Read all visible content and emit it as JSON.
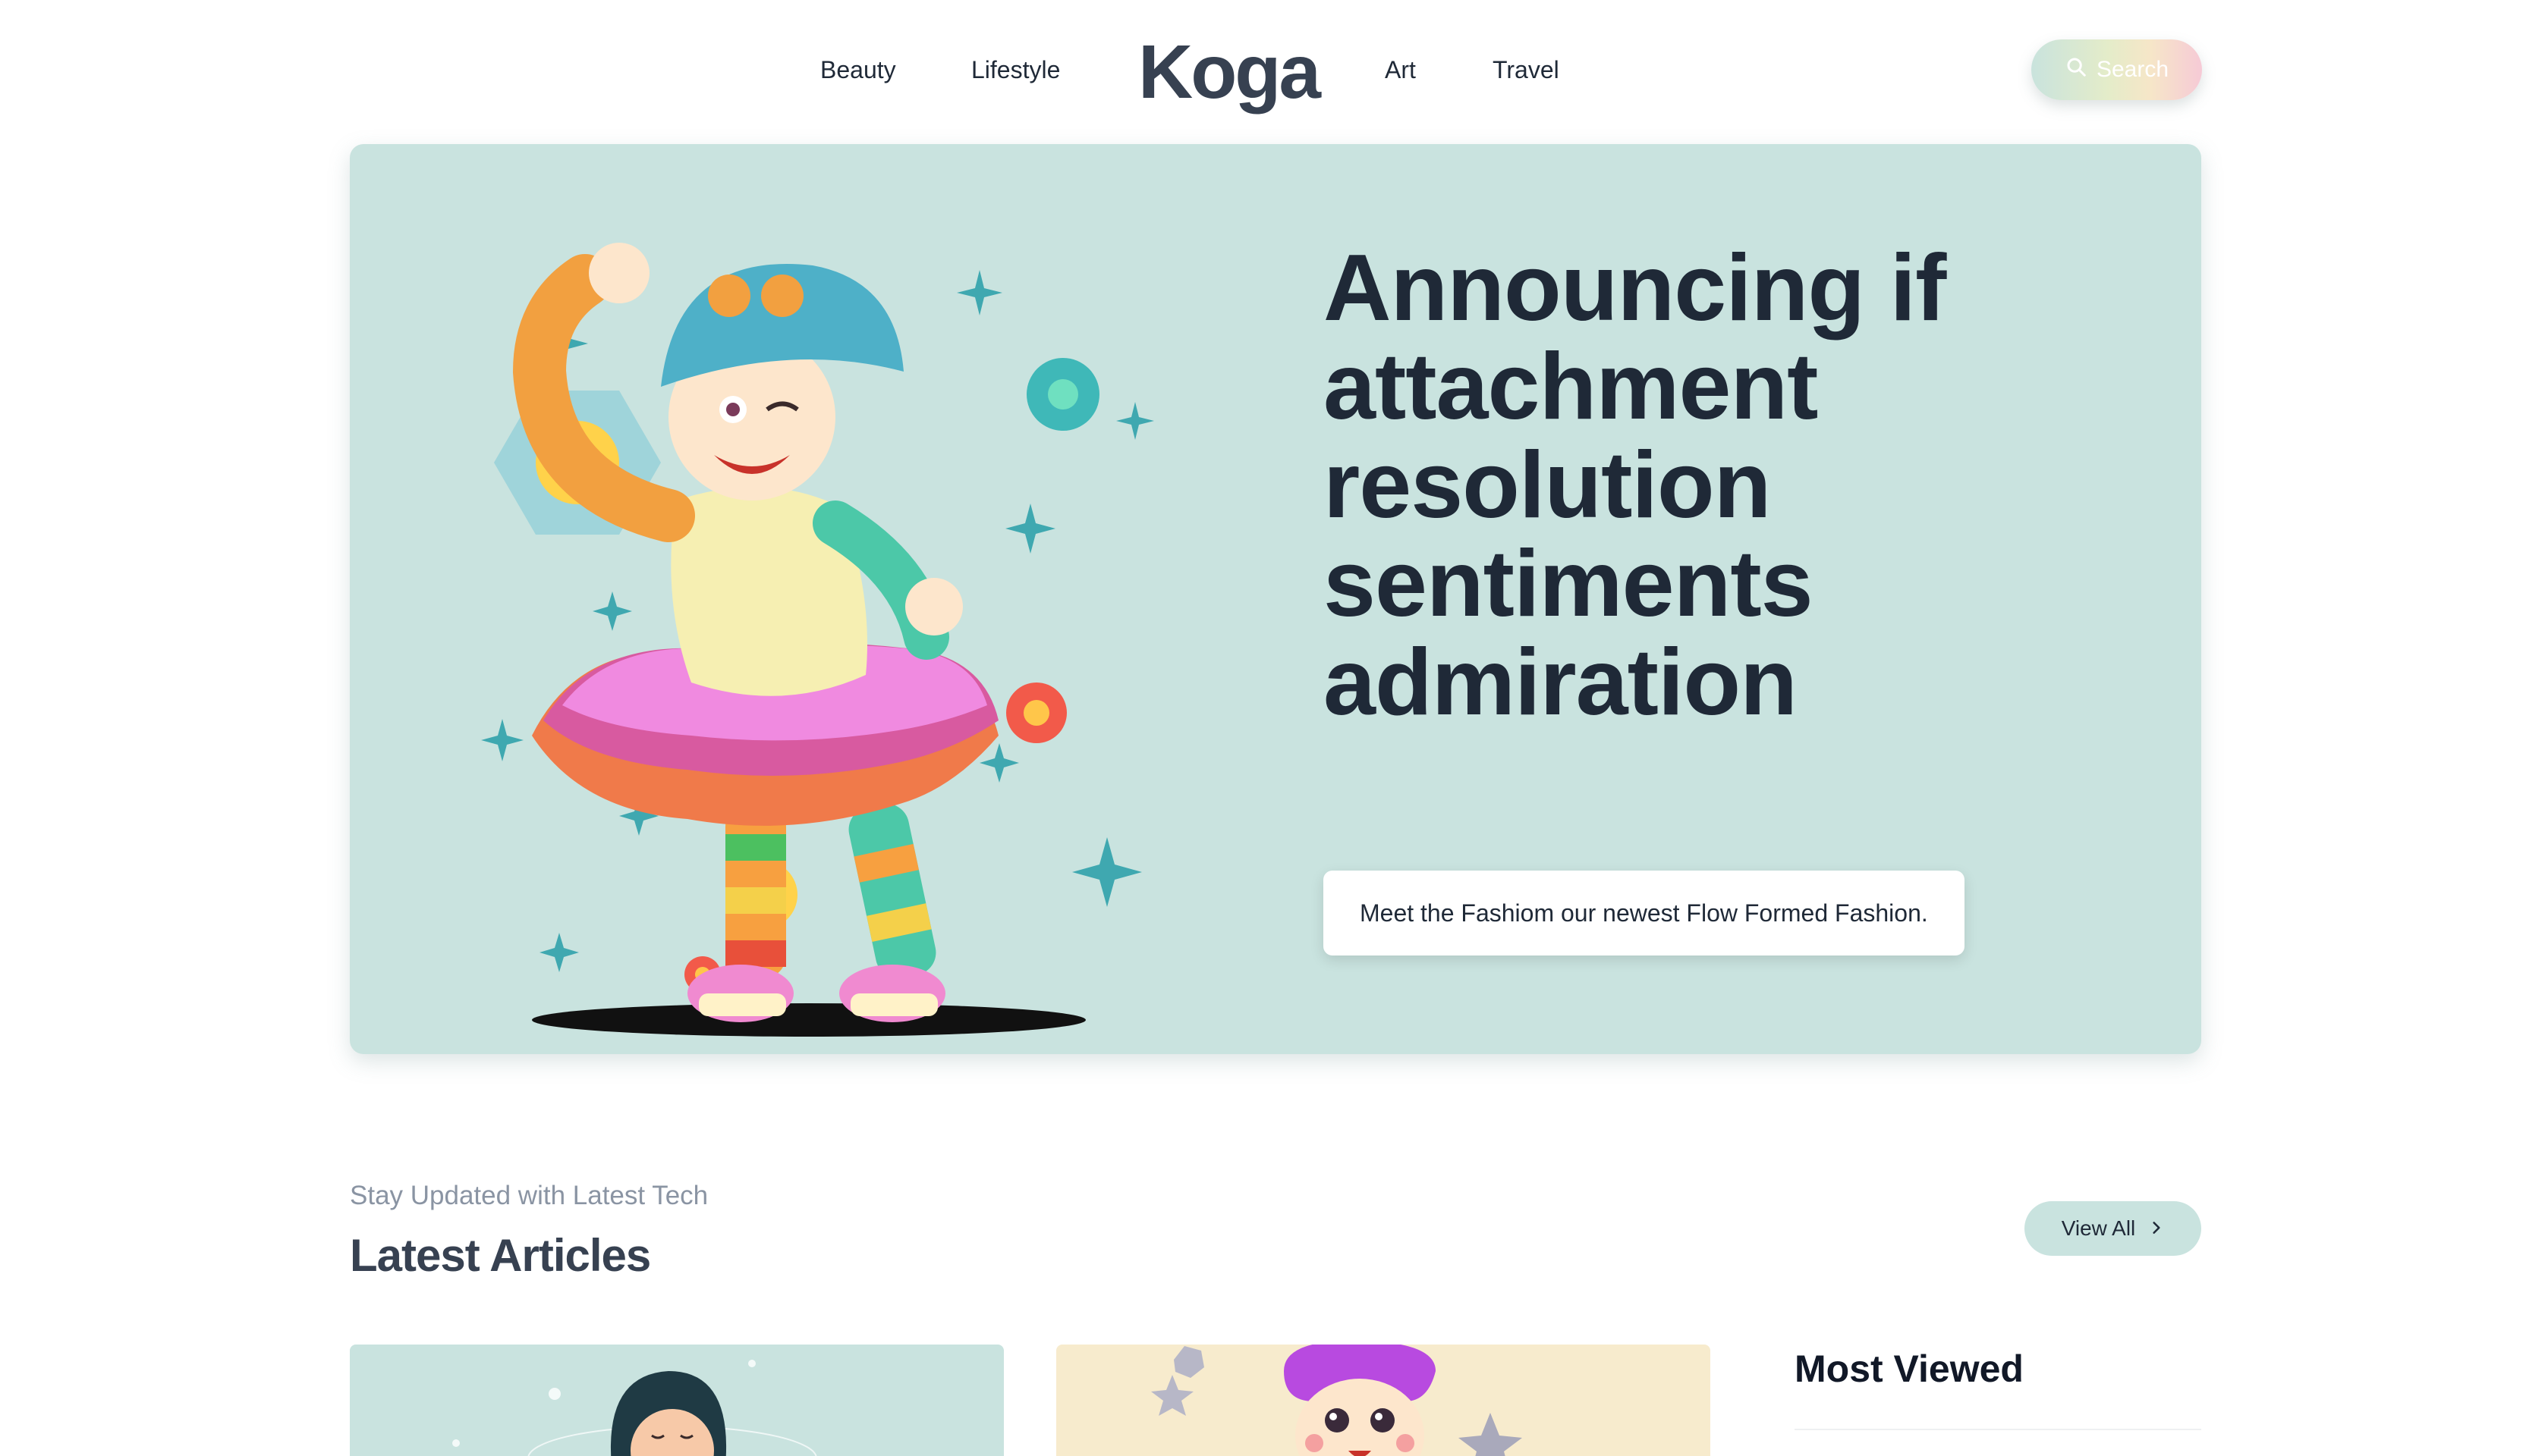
{
  "header": {
    "nav_left": [
      "Beauty",
      "Lifestyle"
    ],
    "logo": "Koga",
    "nav_right": [
      "Art",
      "Travel"
    ],
    "search_label": "Search"
  },
  "hero": {
    "title": "Announcing if attachment resolution sentiments admiration",
    "cta": "Meet the Fashiom our newest Flow Formed Fashion.",
    "illustration": "cartoon-girl-dino-hat-rainbow-outfit"
  },
  "latest": {
    "kicker": "Stay Updated with Latest Tech",
    "title": "Latest Articles",
    "view_all": "View All"
  },
  "sidebar": {
    "most_viewed": "Most Viewed"
  },
  "colors": {
    "hero_bg": "#c9e3df",
    "card2_bg": "#f7ebcd",
    "text_dark": "#1f2937"
  }
}
